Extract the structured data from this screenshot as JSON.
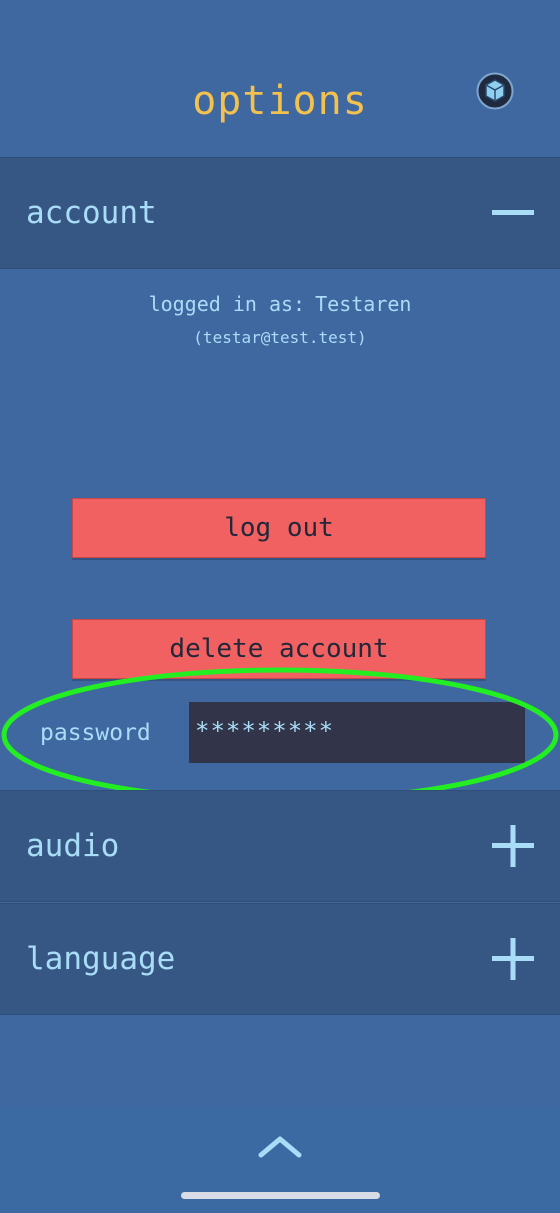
{
  "header": {
    "title": "options",
    "cube_icon": "cube-icon"
  },
  "sections": {
    "account": {
      "label": "account",
      "toggle_icon": "minus-icon",
      "expanded": true
    },
    "audio": {
      "label": "audio",
      "toggle_icon": "plus-icon",
      "expanded": false
    },
    "language": {
      "label": "language",
      "toggle_icon": "plus-icon",
      "expanded": false
    }
  },
  "account": {
    "logged_in_prefix": "logged in as:",
    "username": "Testaren",
    "email": "(testar@test.test)",
    "logout_label": "log out",
    "delete_label": "delete account",
    "password_label": "password",
    "password_value": "*********"
  },
  "footer": {
    "chevron_icon": "chevron-up-icon"
  },
  "colors": {
    "background": "#4068a0",
    "section_header": "#365784",
    "title": "#f2c14e",
    "text": "#a9dcf7",
    "danger_button": "#f26161",
    "input_background": "#323449",
    "highlight_ring": "#22ee22"
  }
}
